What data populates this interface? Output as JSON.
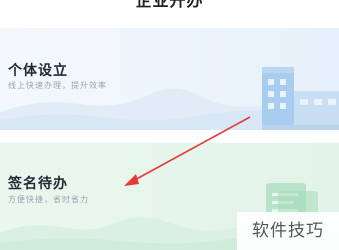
{
  "header": {
    "title": "企业开办"
  },
  "cards": [
    {
      "title": "个体设立",
      "subtitle": "线上快速办理，提升效率",
      "icon": "building-icon",
      "accent": "#8ab8e6"
    },
    {
      "title": "签名待办",
      "subtitle": "方便快捷，省时省力",
      "icon": "document-icon",
      "accent": "#9fd9b6"
    }
  ],
  "annotation": {
    "arrow_color": "#e53935"
  },
  "watermark": {
    "text": "软件技巧"
  }
}
